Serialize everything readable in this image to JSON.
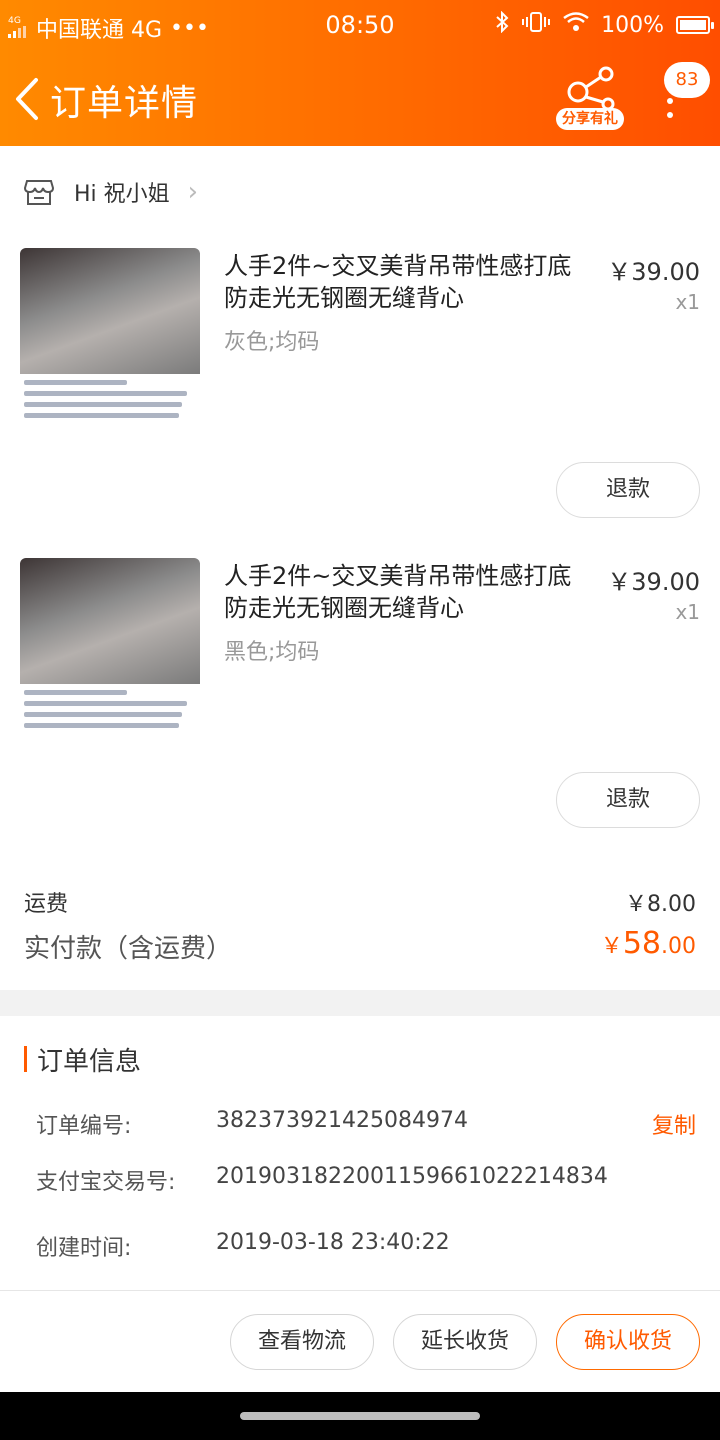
{
  "status_bar": {
    "signal_text": "4G",
    "carrier": "中国联通 4G",
    "time": "08:50",
    "battery": "100%"
  },
  "header": {
    "title": "订单详情",
    "share_label": "分享有礼",
    "badge_count": "83"
  },
  "seller": {
    "name": "Hi 祝小姐"
  },
  "items": [
    {
      "name": "人手2件~交叉美背吊带性感打底防走光无钢圈无缝背心",
      "spec": "灰色;均码",
      "price": "￥39.00",
      "qty": "x1",
      "refund_label": "退款"
    },
    {
      "name": "人手2件~交叉美背吊带性感打底防走光无钢圈无缝背心",
      "spec": "黑色;均码",
      "price": "￥39.00",
      "qty": "x1",
      "refund_label": "退款"
    }
  ],
  "totals": {
    "shipping_label": "运费",
    "shipping_value": "￥8.00",
    "paid_label": "实付款（含运费）",
    "paid_currency": "￥",
    "paid_int": "58",
    "paid_dec": ".00"
  },
  "order_info": {
    "title": "订单信息",
    "order_no_label": "订单编号:",
    "order_no": "382373921425084974",
    "copy_label": "复制",
    "alipay_label": "支付宝交易号:",
    "alipay_no": "2019031822001159661022214834",
    "created_label": "创建时间:",
    "created_time": "2019-03-18 23:40:22"
  },
  "actions": {
    "logistics": "查看物流",
    "extend": "延长收货",
    "confirm": "确认收货"
  },
  "colors": {
    "accent": "#ff5a00",
    "header_start": "#ff8a00",
    "header_end": "#ff4e00"
  }
}
